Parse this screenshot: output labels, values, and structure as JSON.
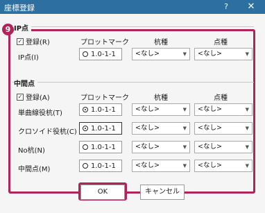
{
  "window": {
    "title": "座標登録",
    "help_label": "?",
    "close_label": "✕"
  },
  "badge": "9",
  "ip_section": {
    "title": "IP点",
    "register_label": "登録(R)",
    "register_checked": true,
    "headers": {
      "plot_mark": "プロットマーク",
      "stake": "杭種",
      "point": "点種"
    },
    "rows": [
      {
        "label": "IP点(I)",
        "plot_value": "1.0-1-1",
        "stake": "<なし>",
        "point": "<なし>"
      }
    ]
  },
  "mid_section": {
    "title": "中間点",
    "register_label": "登録(A)",
    "register_checked": true,
    "headers": {
      "plot_mark": "プロットマーク",
      "stake": "杭種",
      "point": "点種"
    },
    "rows": [
      {
        "label": "単曲線役杭(T)",
        "plot_value": "1.0-1-1",
        "stake": "<なし>",
        "point": "<なし>"
      },
      {
        "label": "クロソイド役杭(C)",
        "plot_value": "1.0-1-1",
        "stake": "<なし>",
        "point": "<なし>"
      },
      {
        "label": "No杭(N)",
        "plot_value": "1.0-1-1",
        "stake": "<なし>",
        "point": "<なし>"
      },
      {
        "label": "中間点(M)",
        "plot_value": "1.0-1-1",
        "stake": "<なし>",
        "point": "<なし>"
      }
    ]
  },
  "buttons": {
    "ok": "OK",
    "cancel": "キャンセル"
  },
  "colors": {
    "titlebar": "#2d6fa0",
    "highlight": "#b0245a"
  }
}
